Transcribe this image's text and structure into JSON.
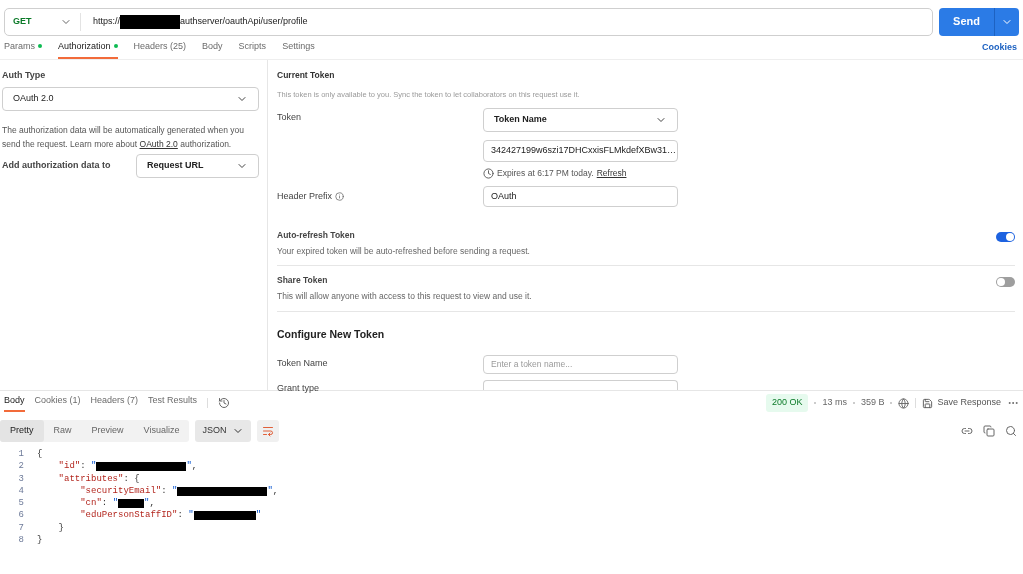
{
  "request": {
    "method": "GET",
    "url_prefix": "https://",
    "url_suffix": "authserver/oauthApi/user/profile",
    "send": "Send"
  },
  "tabs": [
    {
      "label": "Params",
      "dot": true,
      "selected": false
    },
    {
      "label": "Authorization",
      "dot": true,
      "selected": true
    },
    {
      "label": "Headers (25)",
      "dot": false,
      "selected": false
    },
    {
      "label": "Body",
      "dot": false,
      "selected": false
    },
    {
      "label": "Scripts",
      "dot": false,
      "selected": false
    },
    {
      "label": "Settings",
      "dot": false,
      "selected": false
    }
  ],
  "cookies_link": "Cookies",
  "auth": {
    "type_label": "Auth Type",
    "type_value": "OAuth 2.0",
    "description_before": "The authorization data will be automatically generated when you send the request. Learn more about",
    "description_link": "OAuth 2.0",
    "description_after": "authorization.",
    "add_to_label": "Add authorization data to",
    "add_to_value": "Request URL"
  },
  "current_token": {
    "title": "Current Token",
    "note": "This token is only available to you. Sync the token to let collaborators on this request use it.",
    "token_label": "Token",
    "token_select": "Token Name",
    "token_value": "342427199w6szi17DHCxxisFLMkdefXBw31…",
    "expires": "Expires at 6:17 PM today.",
    "refresh": "Refresh",
    "header_prefix_label": "Header Prefix",
    "header_prefix_value": "OAuth",
    "toggles": [
      {
        "title": "Auto-refresh Token",
        "description": "Your expired token will be auto-refreshed before sending a request.",
        "on": true
      },
      {
        "title": "Share Token",
        "description": "This will allow anyone with access to this request to view and use it.",
        "on": false
      }
    ]
  },
  "configure": {
    "title": "Configure New Token",
    "fields": [
      {
        "label": "Token Name",
        "placeholder": "Enter a token name..."
      },
      {
        "label": "Grant type"
      }
    ]
  },
  "response": {
    "tabs": [
      {
        "label": "Body",
        "selected": true
      },
      {
        "label": "Cookies (1)",
        "selected": false
      },
      {
        "label": "Headers (7)",
        "selected": false
      },
      {
        "label": "Test Results",
        "selected": false
      }
    ],
    "status": "200 OK",
    "time": "13 ms",
    "size": "359 B",
    "save": "Save Response",
    "views": [
      {
        "label": "Pretty",
        "selected": true
      },
      {
        "label": "Raw",
        "selected": false
      },
      {
        "label": "Preview",
        "selected": false
      },
      {
        "label": "Visualize",
        "selected": false
      }
    ],
    "format": "JSON",
    "lines": [
      {
        "number": "1",
        "parts": [
          {
            "kind": "punct",
            "text": "{"
          }
        ]
      },
      {
        "number": "2",
        "parts": [
          {
            "kind": "key",
            "text": "    \"id\""
          },
          {
            "kind": "punct",
            "text": ": "
          },
          {
            "kind": "string",
            "text": "\""
          },
          {
            "kind": "redacted"
          },
          {
            "kind": "string",
            "text": "\""
          },
          {
            "kind": "punct",
            "text": ","
          }
        ]
      },
      {
        "number": "3",
        "parts": [
          {
            "kind": "key",
            "text": "    \"attributes\""
          },
          {
            "kind": "punct",
            "text": ": {"
          }
        ]
      },
      {
        "number": "4",
        "parts": [
          {
            "kind": "key",
            "text": "        \"securityEmail\""
          },
          {
            "kind": "punct",
            "text": ": "
          },
          {
            "kind": "string",
            "text": "\""
          },
          {
            "kind": "redacted"
          },
          {
            "kind": "string",
            "text": "\""
          },
          {
            "kind": "punct",
            "text": ","
          }
        ]
      },
      {
        "number": "5",
        "parts": [
          {
            "kind": "key",
            "text": "        \"cn\""
          },
          {
            "kind": "punct",
            "text": ": "
          },
          {
            "kind": "string",
            "text": "\""
          },
          {
            "kind": "redacted"
          },
          {
            "kind": "string",
            "text": "\""
          },
          {
            "kind": "punct",
            "text": ","
          }
        ]
      },
      {
        "number": "6",
        "parts": [
          {
            "kind": "key",
            "text": "        \"eduPersonStaffID\""
          },
          {
            "kind": "punct",
            "text": ": "
          },
          {
            "kind": "string",
            "text": "\""
          },
          {
            "kind": "redacted"
          },
          {
            "kind": "string",
            "text": "\""
          }
        ]
      },
      {
        "number": "7",
        "parts": [
          {
            "kind": "punct",
            "text": "    }"
          }
        ]
      },
      {
        "number": "8",
        "parts": [
          {
            "kind": "punct",
            "text": "}"
          }
        ]
      }
    ]
  }
}
